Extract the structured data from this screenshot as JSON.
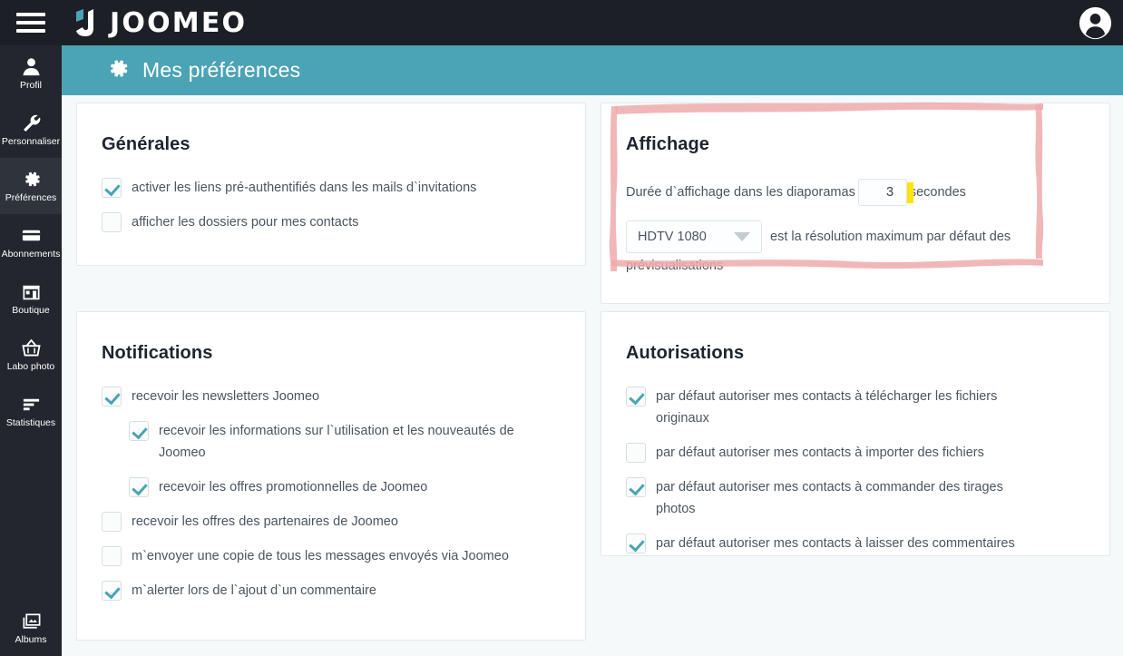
{
  "topbar": {
    "menu_icon": "hamburger-icon",
    "brand": "JOOMEO",
    "avatar_icon": "user-avatar-icon"
  },
  "sidebar": {
    "items": [
      {
        "label": "Profil",
        "icon": "user-icon",
        "active": false
      },
      {
        "label": "Personnaliser",
        "icon": "wrench-icon",
        "active": false
      },
      {
        "label": "Préférences",
        "icon": "gear-icon",
        "active": true
      },
      {
        "label": "Abonnements",
        "icon": "card-icon",
        "active": false
      },
      {
        "label": "Boutique",
        "icon": "shop-icon",
        "active": false
      },
      {
        "label": "Labo photo",
        "icon": "basket-icon",
        "active": false
      },
      {
        "label": "Statistiques",
        "icon": "bars-icon",
        "active": false
      }
    ],
    "bottom_item": {
      "label": "Albums",
      "icon": "albums-icon"
    }
  },
  "page_header": {
    "icon": "gear-icon",
    "title": "Mes préférences"
  },
  "cards": {
    "generales": {
      "title": "Générales",
      "options": [
        {
          "label": "activer les liens pré-authentifiés dans les mails d`invitations",
          "checked": true
        },
        {
          "label": "afficher les dossiers pour mes contacts",
          "checked": false
        }
      ]
    },
    "affichage": {
      "title": "Affichage",
      "duration_prefix": "Durée d`affichage dans les diaporamas",
      "duration_value": "3",
      "duration_suffix": "secondes",
      "resolution_value": "HDTV 1080",
      "resolution_suffix": "est la résolution maximum par défaut des prévisualisations",
      "highlight_color": "#ffe500",
      "annotation_color": "#eeaaab"
    },
    "notifications": {
      "title": "Notifications",
      "options": [
        {
          "label": "recevoir les newsletters Joomeo",
          "checked": true,
          "indent": false
        },
        {
          "label": "recevoir les informations sur l`utilisation et les nouveautés de Joomeo",
          "checked": true,
          "indent": true
        },
        {
          "label": "recevoir les offres promotionnelles de Joomeo",
          "checked": true,
          "indent": true
        },
        {
          "label": "recevoir les offres des partenaires de Joomeo",
          "checked": false,
          "indent": false
        },
        {
          "label": "m`envoyer une copie de tous les messages envoyés via Joomeo",
          "checked": false,
          "indent": false
        },
        {
          "label": "m`alerter lors de l`ajout d`un commentaire",
          "checked": true,
          "indent": false
        }
      ]
    },
    "autorisations": {
      "title": "Autorisations",
      "options": [
        {
          "label": "par défaut autoriser mes contacts à télécharger les fichiers originaux",
          "checked": true
        },
        {
          "label": "par défaut autoriser mes contacts à importer des fichiers",
          "checked": false
        },
        {
          "label": "par défaut autoriser mes contacts à commander des tirages photos",
          "checked": true
        },
        {
          "label": "par défaut autoriser mes contacts à laisser des commentaires",
          "checked": true
        }
      ]
    }
  },
  "theme": {
    "topbar_bg": "#1c1f26",
    "sidebar_bg": "#23262e",
    "accent": "#4ba3b6",
    "page_bg": "#f5f9fa",
    "card_bg": "#ffffff"
  }
}
